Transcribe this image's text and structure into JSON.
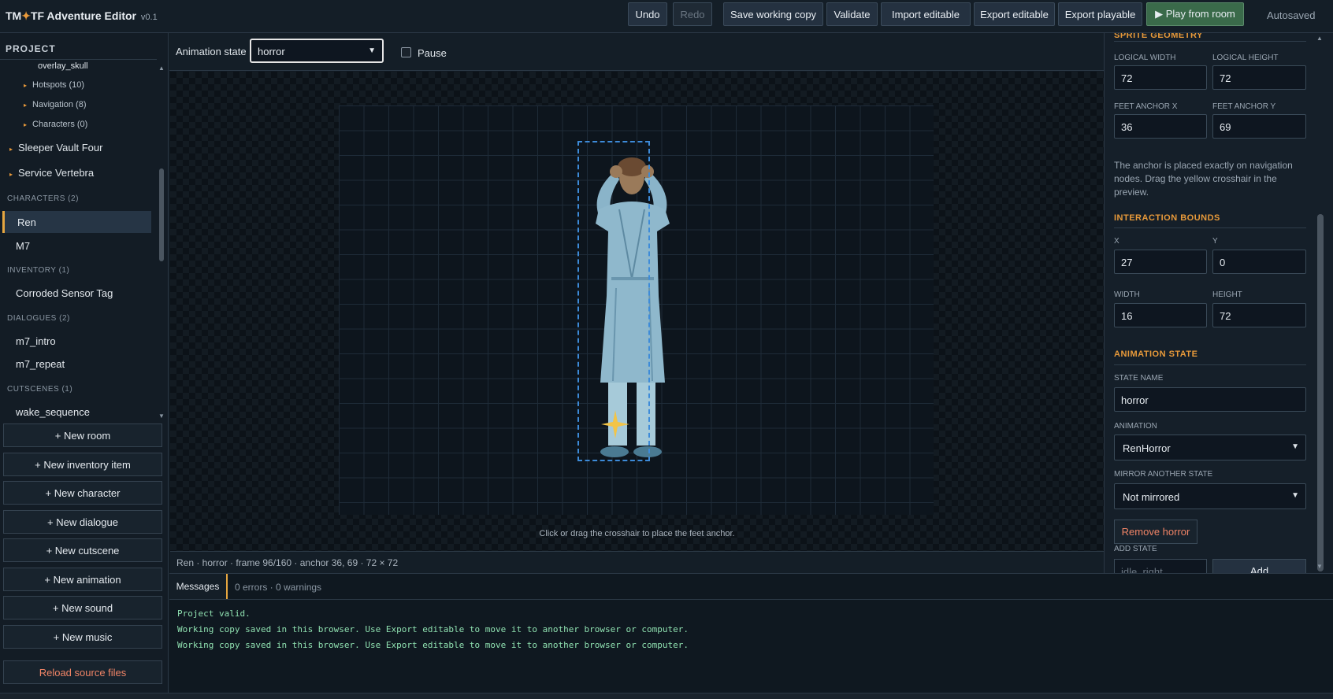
{
  "app": {
    "brand_pre": "TM",
    "brand_star": "✦",
    "brand_post": "TF Adventure Editor",
    "version": "v0.1",
    "autosave_status": "Autosaved"
  },
  "toolbar": {
    "undo": "Undo",
    "redo": "Redo",
    "save": "Save working copy",
    "validate": "Validate",
    "import": "Import editable",
    "export_editable": "Export editable",
    "export_playable": "Export playable",
    "play": "▶ Play from room"
  },
  "sidebar": {
    "title": "PROJECT",
    "tree": [
      {
        "label": "overlay_skull"
      },
      {
        "label": "Hotspots (10)"
      },
      {
        "label": "Navigation (8)"
      },
      {
        "label": "Characters (0)"
      },
      {
        "label": "Sleeper Vault Four"
      },
      {
        "label": "Service Vertebra"
      }
    ],
    "sections": {
      "characters": {
        "title": "CHARACTERS (2)",
        "items": [
          "Ren",
          "M7"
        ]
      },
      "inventory": {
        "title": "INVENTORY (1)",
        "items": [
          "Corroded Sensor Tag"
        ]
      },
      "dialogues": {
        "title": "DIALOGUES (2)",
        "items": [
          "m7_intro",
          "m7_repeat"
        ]
      },
      "cutscenes": {
        "title": "CUTSCENES (1)",
        "items": [
          "wake_sequence"
        ]
      }
    },
    "buttons": [
      "+ New room",
      "+ New inventory item",
      "+ New character",
      "+ New dialogue",
      "+ New cutscene",
      "+ New animation",
      "+ New sound",
      "+ New music"
    ],
    "reload": "Reload source files"
  },
  "editor": {
    "animation_state_label": "Animation state",
    "animation_state_value": "horror",
    "pause_label": "Pause",
    "pause_checked": false,
    "hint": "Click or drag the crosshair to place the feet anchor.",
    "status": "Ren · horror · frame 96/160 · anchor 36, 69 · 72 × 72"
  },
  "inspector": {
    "sprite_geometry": {
      "title": "SPRITE GEOMETRY",
      "logical_width_label": "LOGICAL WIDTH",
      "logical_width": "72",
      "logical_height_label": "LOGICAL HEIGHT",
      "logical_height": "72",
      "feet_x_label": "FEET ANCHOR X",
      "feet_x": "36",
      "feet_y_label": "FEET ANCHOR Y",
      "feet_y": "69",
      "note": "The anchor is placed exactly on navigation nodes. Drag the yellow crosshair in the preview."
    },
    "interaction_bounds": {
      "title": "INTERACTION BOUNDS",
      "x_label": "X",
      "x": "27",
      "y_label": "Y",
      "y": "0",
      "width_label": "WIDTH",
      "width": "16",
      "height_label": "HEIGHT",
      "height": "72"
    },
    "animation_state": {
      "title": "ANIMATION STATE",
      "state_name_label": "STATE NAME",
      "state_name": "horror",
      "animation_label": "ANIMATION",
      "animation": "RenHorror",
      "mirror_label": "MIRROR ANOTHER STATE",
      "mirror": "Not mirrored",
      "remove": "Remove horror",
      "add_state_label": "ADD STATE",
      "add_placeholder": "idle_right",
      "add": "Add"
    }
  },
  "messages": {
    "tab": "Messages",
    "count": "0 errors · 0 warnings",
    "lines": [
      "Project valid.",
      "Working copy saved in this browser. Use Export editable to move it to another browser or computer.",
      "Working copy saved in this browser. Use Export editable to move it to another browser or computer."
    ]
  },
  "colors": {
    "accent": "#e6a640",
    "bounds": "#3d8bd9",
    "anchor": "#f2c447",
    "success_text": "#8fe0b0",
    "danger_text": "#f08466"
  }
}
